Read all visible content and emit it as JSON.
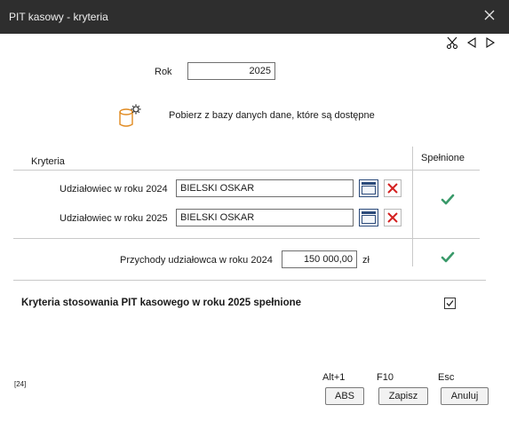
{
  "window": {
    "title": "PIT kasowy - kryteria",
    "close_icon": "close-icon"
  },
  "toolbar": {
    "icons": [
      "scissors-icon",
      "arrow-left-icon",
      "arrow-right-icon"
    ]
  },
  "year": {
    "label": "Rok",
    "value": "2025"
  },
  "fetch": {
    "icon": "database-gear-icon",
    "text": "Pobierz z bazy danych dane, które są dostępne"
  },
  "table": {
    "criteria_header": "Kryteria",
    "fulfilled_header": "Spełnione",
    "partner_2024_label": "Udziałowiec w roku 2024",
    "partner_2024_value": "BIELSKI OSKAR",
    "partner_2025_label": "Udziałowiec w roku 2025",
    "partner_2025_value": "BIELSKI OSKAR",
    "revenue_label": "Przychody udziałowca w roku 2024",
    "revenue_value": "150 000,00",
    "revenue_currency": "zł"
  },
  "summary": {
    "text": "Kryteria stosowania PIT kasowego w roku 2025 spełnione",
    "checked": true
  },
  "footer": {
    "code": "[24]",
    "abs_shortcut": "Alt+1",
    "abs_label": "ABS",
    "save_shortcut": "F10",
    "save_label": "Zapisz",
    "cancel_shortcut": "Esc",
    "cancel_label": "Anuluj"
  },
  "colors": {
    "titlebar": "#2e2e2e",
    "check_green": "#3a9a6a",
    "delete_red": "#d42020",
    "db_icon_orange": "#e08a20"
  }
}
